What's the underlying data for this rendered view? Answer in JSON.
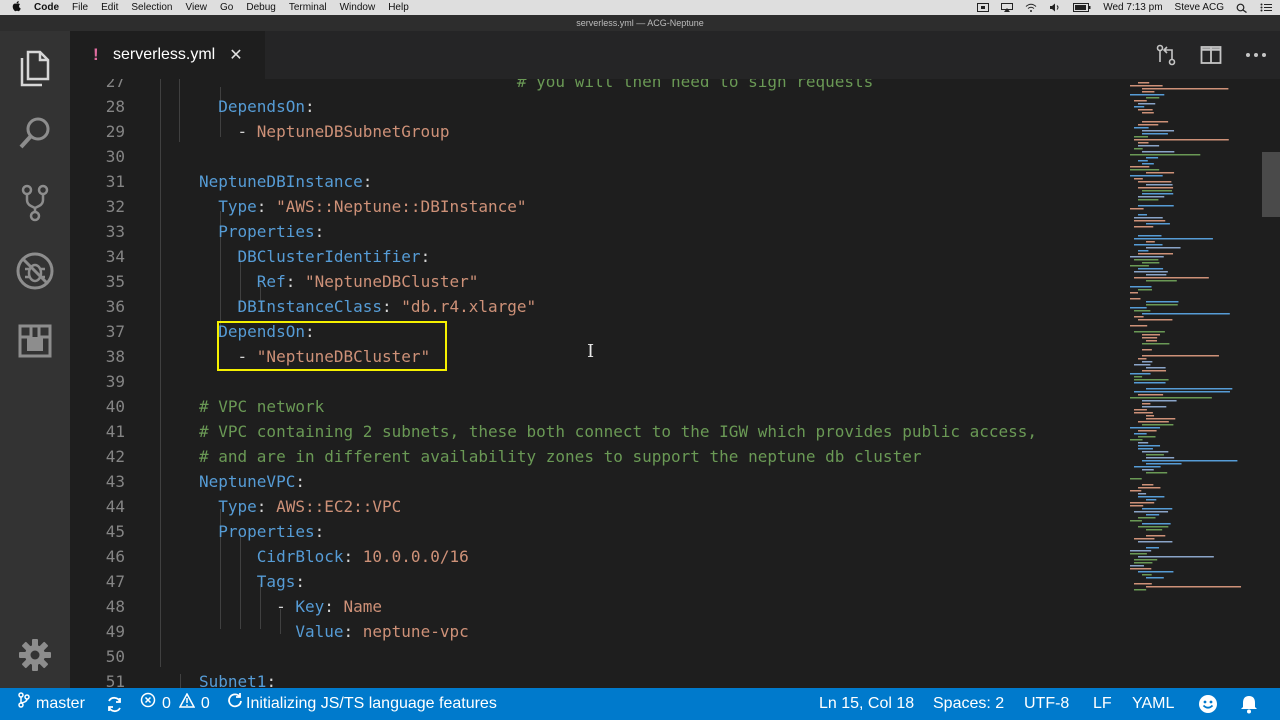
{
  "menubar": {
    "app": "Code",
    "items": [
      "File",
      "Edit",
      "Selection",
      "View",
      "Go",
      "Debug",
      "Terminal",
      "Window",
      "Help"
    ],
    "clock": "Wed 7:13 pm",
    "user": "Steve ACG"
  },
  "window": {
    "title": "serverless.yml — ACG-Neptune"
  },
  "tab": {
    "modified_glyph": "!",
    "filename": "serverless.yml",
    "close_glyph": "✕"
  },
  "editor": {
    "lines": [
      {
        "n": "27",
        "tokens": [
          {
            "t": "                                 ",
            "c": "p"
          },
          {
            "t": "# you will then need to sign requests",
            "c": "c"
          }
        ]
      },
      {
        "n": "28",
        "tokens": [
          {
            "t": "  ",
            "c": "p"
          },
          {
            "t": "DependsOn",
            "c": "k"
          },
          {
            "t": ":",
            "c": "p"
          }
        ]
      },
      {
        "n": "29",
        "tokens": [
          {
            "t": "    - ",
            "c": "p"
          },
          {
            "t": "NeptuneDBSubnetGroup",
            "c": "s"
          }
        ]
      },
      {
        "n": "30",
        "tokens": []
      },
      {
        "n": "31",
        "tokens": [
          {
            "t": "NeptuneDBInstance",
            "c": "k"
          },
          {
            "t": ":",
            "c": "p"
          }
        ]
      },
      {
        "n": "32",
        "tokens": [
          {
            "t": "  ",
            "c": "p"
          },
          {
            "t": "Type",
            "c": "k"
          },
          {
            "t": ": ",
            "c": "p"
          },
          {
            "t": "\"AWS::Neptune::DBInstance\"",
            "c": "s"
          }
        ]
      },
      {
        "n": "33",
        "tokens": [
          {
            "t": "  ",
            "c": "p"
          },
          {
            "t": "Properties",
            "c": "k"
          },
          {
            "t": ":",
            "c": "p"
          }
        ]
      },
      {
        "n": "34",
        "tokens": [
          {
            "t": "    ",
            "c": "p"
          },
          {
            "t": "DBClusterIdentifier",
            "c": "k"
          },
          {
            "t": ":",
            "c": "p"
          }
        ]
      },
      {
        "n": "35",
        "tokens": [
          {
            "t": "      ",
            "c": "p"
          },
          {
            "t": "Ref",
            "c": "k"
          },
          {
            "t": ": ",
            "c": "p"
          },
          {
            "t": "\"NeptuneDBCluster\"",
            "c": "s"
          }
        ]
      },
      {
        "n": "36",
        "tokens": [
          {
            "t": "    ",
            "c": "p"
          },
          {
            "t": "DBInstanceClass",
            "c": "k"
          },
          {
            "t": ": ",
            "c": "p"
          },
          {
            "t": "\"db.r4.xlarge\"",
            "c": "s"
          }
        ]
      },
      {
        "n": "37",
        "tokens": [
          {
            "t": "  ",
            "c": "p"
          },
          {
            "t": "DependsOn",
            "c": "k"
          },
          {
            "t": ":",
            "c": "p"
          }
        ]
      },
      {
        "n": "38",
        "tokens": [
          {
            "t": "    - ",
            "c": "p"
          },
          {
            "t": "\"NeptuneDBCluster\"",
            "c": "s"
          }
        ]
      },
      {
        "n": "39",
        "tokens": []
      },
      {
        "n": "40",
        "tokens": [
          {
            "t": "# VPC network",
            "c": "c"
          }
        ]
      },
      {
        "n": "41",
        "tokens": [
          {
            "t": "# VPC containing 2 subnets, these both connect to the IGW which provides public access,",
            "c": "c"
          }
        ]
      },
      {
        "n": "42",
        "tokens": [
          {
            "t": "# and are in different availability zones to support the neptune db cluster",
            "c": "c"
          }
        ]
      },
      {
        "n": "43",
        "tokens": [
          {
            "t": "NeptuneVPC",
            "c": "k"
          },
          {
            "t": ":",
            "c": "p"
          }
        ]
      },
      {
        "n": "44",
        "tokens": [
          {
            "t": "  ",
            "c": "p"
          },
          {
            "t": "Type",
            "c": "k"
          },
          {
            "t": ": ",
            "c": "p"
          },
          {
            "t": "AWS::EC2::VPC",
            "c": "s"
          }
        ]
      },
      {
        "n": "45",
        "tokens": [
          {
            "t": "  ",
            "c": "p"
          },
          {
            "t": "Properties",
            "c": "k"
          },
          {
            "t": ":",
            "c": "p"
          }
        ]
      },
      {
        "n": "46",
        "tokens": [
          {
            "t": "      ",
            "c": "p"
          },
          {
            "t": "CidrBlock",
            "c": "k"
          },
          {
            "t": ": ",
            "c": "p"
          },
          {
            "t": "10.0.0.0/16",
            "c": "s"
          }
        ]
      },
      {
        "n": "47",
        "tokens": [
          {
            "t": "      ",
            "c": "p"
          },
          {
            "t": "Tags",
            "c": "k"
          },
          {
            "t": ":",
            "c": "p"
          }
        ]
      },
      {
        "n": "48",
        "tokens": [
          {
            "t": "        - ",
            "c": "p"
          },
          {
            "t": "Key",
            "c": "k"
          },
          {
            "t": ": ",
            "c": "p"
          },
          {
            "t": "Name",
            "c": "s"
          }
        ]
      },
      {
        "n": "49",
        "tokens": [
          {
            "t": "          ",
            "c": "p"
          },
          {
            "t": "Value",
            "c": "k"
          },
          {
            "t": ": ",
            "c": "p"
          },
          {
            "t": "neptune-vpc",
            "c": "s"
          }
        ]
      },
      {
        "n": "50",
        "tokens": []
      },
      {
        "n": "51",
        "tokens": [
          {
            "t": "Subnet1",
            "c": "k"
          },
          {
            "t": ":",
            "c": "p"
          }
        ]
      }
    ]
  },
  "statusbar": {
    "branch": "master",
    "errors": "0",
    "warnings": "0",
    "task": "Initializing JS/TS language features",
    "position": "Ln 15, Col 18",
    "spaces": "Spaces: 2",
    "encoding": "UTF-8",
    "eol": "LF",
    "language": "YAML"
  },
  "colors": {
    "statusbar": "#007acc",
    "highlight_box": "#f5f000",
    "keyword": "#569cd6",
    "string": "#ce9178",
    "comment": "#6a9955"
  }
}
